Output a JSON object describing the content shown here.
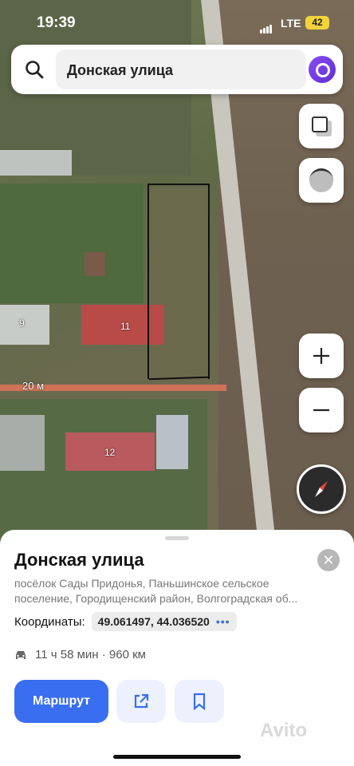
{
  "status_bar": {
    "time": "19:39",
    "network": "LTE",
    "battery": "42"
  },
  "search": {
    "query": "Донская улица"
  },
  "map": {
    "house_numbers": [
      "9",
      "11",
      "12"
    ],
    "ruler_label": "20 м"
  },
  "place": {
    "title": "Донская улица",
    "address_line1": "посёлок Сады Придонья, Паньшинское сельское",
    "address_line2": "поселение, Городищенский район, Волгоградская об...",
    "coords_label": "Координаты:",
    "coords_value": "49.061497, 44.036520",
    "route_time": "11 ч 58 мин · 960 км",
    "route_button": "Маршрут"
  },
  "watermark": "Avito",
  "colors": {
    "accent": "#3a6ef0",
    "battery": "#f2d33b",
    "ruler": "#e0735a"
  }
}
